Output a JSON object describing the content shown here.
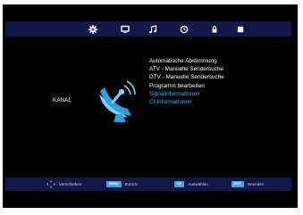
{
  "menu": {
    "items": [
      {
        "label": "Automatische Abstimmung",
        "highlighted": false
      },
      {
        "label": "ATV - Manuelle Sendersuche",
        "highlighted": false
      },
      {
        "label": "DTV - Manuelle Sendersuche",
        "highlighted": false
      },
      {
        "label": "Programm bearbeiten",
        "highlighted": false
      },
      {
        "label": "Signalinformationen",
        "highlighted": true
      },
      {
        "label": "CI-Informationen",
        "highlighted": true
      }
    ]
  },
  "section": {
    "label": "KANAL",
    "icon": "satellite-dish-icon"
  },
  "topbar": {
    "icons": [
      "settings-gear-icon",
      "monitor-icon",
      "music-note-icon",
      "clock-icon",
      "lock-icon",
      "square-icon"
    ]
  },
  "footer": {
    "move_label": "Verschieben",
    "back_key": "MENU",
    "back_label": "Zurück",
    "select_key": "OK",
    "select_label": "Auswählen",
    "exit_key": "EXIT",
    "exit_label": "Beenden"
  },
  "colors": {
    "bar": "#12174a",
    "highlight": "#3fb4ea",
    "accent": "#49a2d8"
  }
}
